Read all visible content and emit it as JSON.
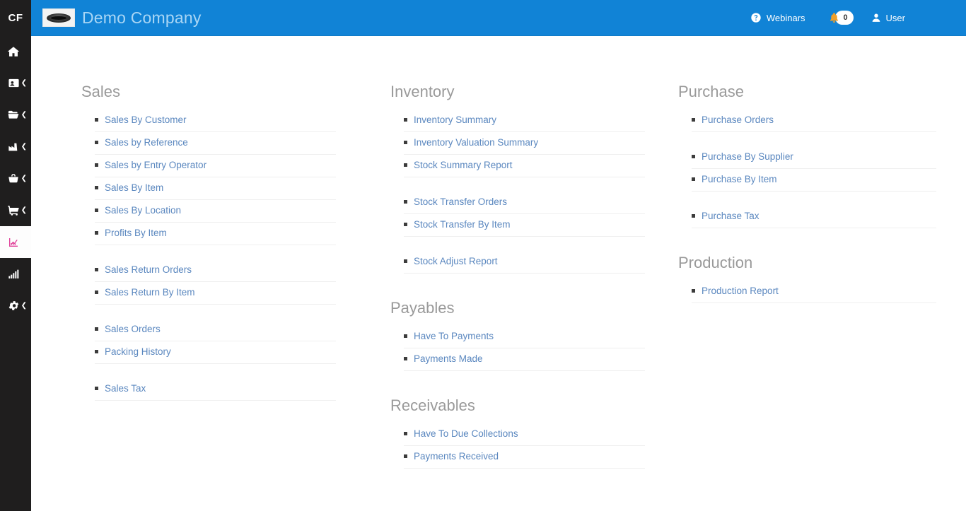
{
  "app": {
    "brand_short": "CF",
    "company_name": "Demo Company",
    "accent_blue": "#1183d6",
    "link_blue": "#5a87bf",
    "heading_gray": "#9a9a9a",
    "sidebar_dark": "#1f1e1e",
    "active_pink": "#e0429a",
    "bell_orange": "#f0a02a"
  },
  "sidebar": {
    "logo_label": "CF",
    "items": [
      {
        "name": "home",
        "icon": "home-icon",
        "has_caret": false,
        "active": false
      },
      {
        "name": "contacts",
        "icon": "id-card-icon",
        "has_caret": true,
        "active": false
      },
      {
        "name": "files",
        "icon": "folder-open-icon",
        "has_caret": true,
        "active": false
      },
      {
        "name": "production",
        "icon": "factory-icon",
        "has_caret": true,
        "active": false
      },
      {
        "name": "inventory",
        "icon": "basket-icon",
        "has_caret": true,
        "active": false
      },
      {
        "name": "sales",
        "icon": "shopping-cart-icon",
        "has_caret": true,
        "active": false
      },
      {
        "name": "reports",
        "icon": "chart-line-icon",
        "has_caret": false,
        "active": true
      },
      {
        "name": "analytics",
        "icon": "signal-bars-icon",
        "has_caret": false,
        "active": false
      },
      {
        "name": "settings",
        "icon": "gear-icon",
        "has_caret": true,
        "active": false
      }
    ]
  },
  "header": {
    "company_name": "Demo Company",
    "logo_alt": "company-logo",
    "webinars_label": "Webinars",
    "webinars_icon": "question-circle-icon",
    "notifications_icon": "bell-icon",
    "notifications_count": "0",
    "user_label": "User",
    "user_icon": "user-icon"
  },
  "columns": [
    {
      "id": "column-1",
      "sections": [
        {
          "id": "sales",
          "title": "Sales",
          "items": [
            {
              "label": "Sales By Customer"
            },
            {
              "label": "Sales by Reference"
            },
            {
              "label": "Sales by Entry Operator"
            },
            {
              "label": "Sales By Item"
            },
            {
              "label": "Sales By Location"
            },
            {
              "label": "Profits By Item"
            },
            {
              "gap": true
            },
            {
              "label": "Sales Return Orders"
            },
            {
              "label": "Sales Return By Item"
            },
            {
              "gap": true
            },
            {
              "label": "Sales Orders"
            },
            {
              "label": "Packing History"
            },
            {
              "gap": true
            },
            {
              "label": "Sales Tax"
            }
          ]
        }
      ]
    },
    {
      "id": "column-2",
      "sections": [
        {
          "id": "inventory",
          "title": "Inventory",
          "items": [
            {
              "label": "Inventory Summary"
            },
            {
              "label": "Inventory Valuation Summary"
            },
            {
              "label": "Stock Summary Report"
            },
            {
              "gap": true
            },
            {
              "label": "Stock Transfer Orders"
            },
            {
              "label": "Stock Transfer By Item"
            },
            {
              "gap": true
            },
            {
              "label": "Stock Adjust Report"
            }
          ]
        },
        {
          "id": "payables",
          "title": "Payables",
          "items": [
            {
              "label": "Have To Payments"
            },
            {
              "label": "Payments Made"
            }
          ]
        },
        {
          "id": "receivables",
          "title": "Receivables",
          "items": [
            {
              "label": "Have To Due Collections"
            },
            {
              "label": "Payments Received"
            }
          ]
        }
      ]
    },
    {
      "id": "column-3",
      "sections": [
        {
          "id": "purchase",
          "title": "Purchase",
          "items": [
            {
              "label": "Purchase Orders"
            },
            {
              "gap": true
            },
            {
              "label": "Purchase By Supplier"
            },
            {
              "label": "Purchase By Item"
            },
            {
              "gap": true
            },
            {
              "label": "Purchase Tax"
            }
          ]
        },
        {
          "id": "production",
          "title": "Production",
          "items": [
            {
              "label": "Production Report"
            }
          ]
        }
      ]
    }
  ]
}
